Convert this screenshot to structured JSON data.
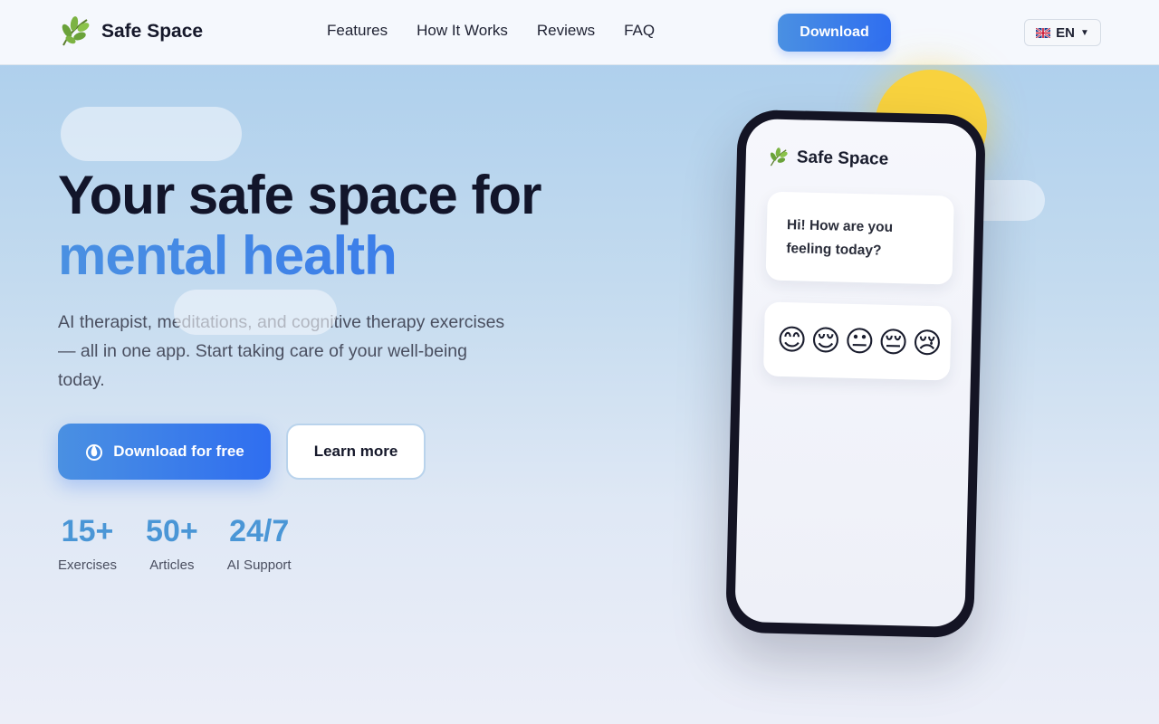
{
  "header": {
    "brand": "Safe Space",
    "nav": [
      "Features",
      "How It Works",
      "Reviews",
      "FAQ"
    ],
    "download_label": "Download",
    "language": "EN"
  },
  "hero": {
    "title_line1": "Your safe space for",
    "title_line2": "mental health",
    "subtitle": "AI therapist, meditations, and cognitive therapy exercises — all in one app. Start taking care of your well-being today.",
    "primary_button": "Download for free",
    "secondary_button": "Learn more",
    "stats": [
      {
        "value": "15+",
        "label": "Exercises"
      },
      {
        "value": "50+",
        "label": "Articles"
      },
      {
        "value": "24/7",
        "label": "AI Support"
      }
    ]
  },
  "phone": {
    "brand": "Safe Space",
    "greeting": "Hi! How are you feeling today?",
    "moods": [
      "😊",
      "😌",
      "😐",
      "😔",
      "😢"
    ]
  },
  "colors": {
    "accent": "#2f6ef0",
    "accent_light": "#4a90e2",
    "stat_color": "#4a96d6",
    "sun": "#f8d23e"
  }
}
